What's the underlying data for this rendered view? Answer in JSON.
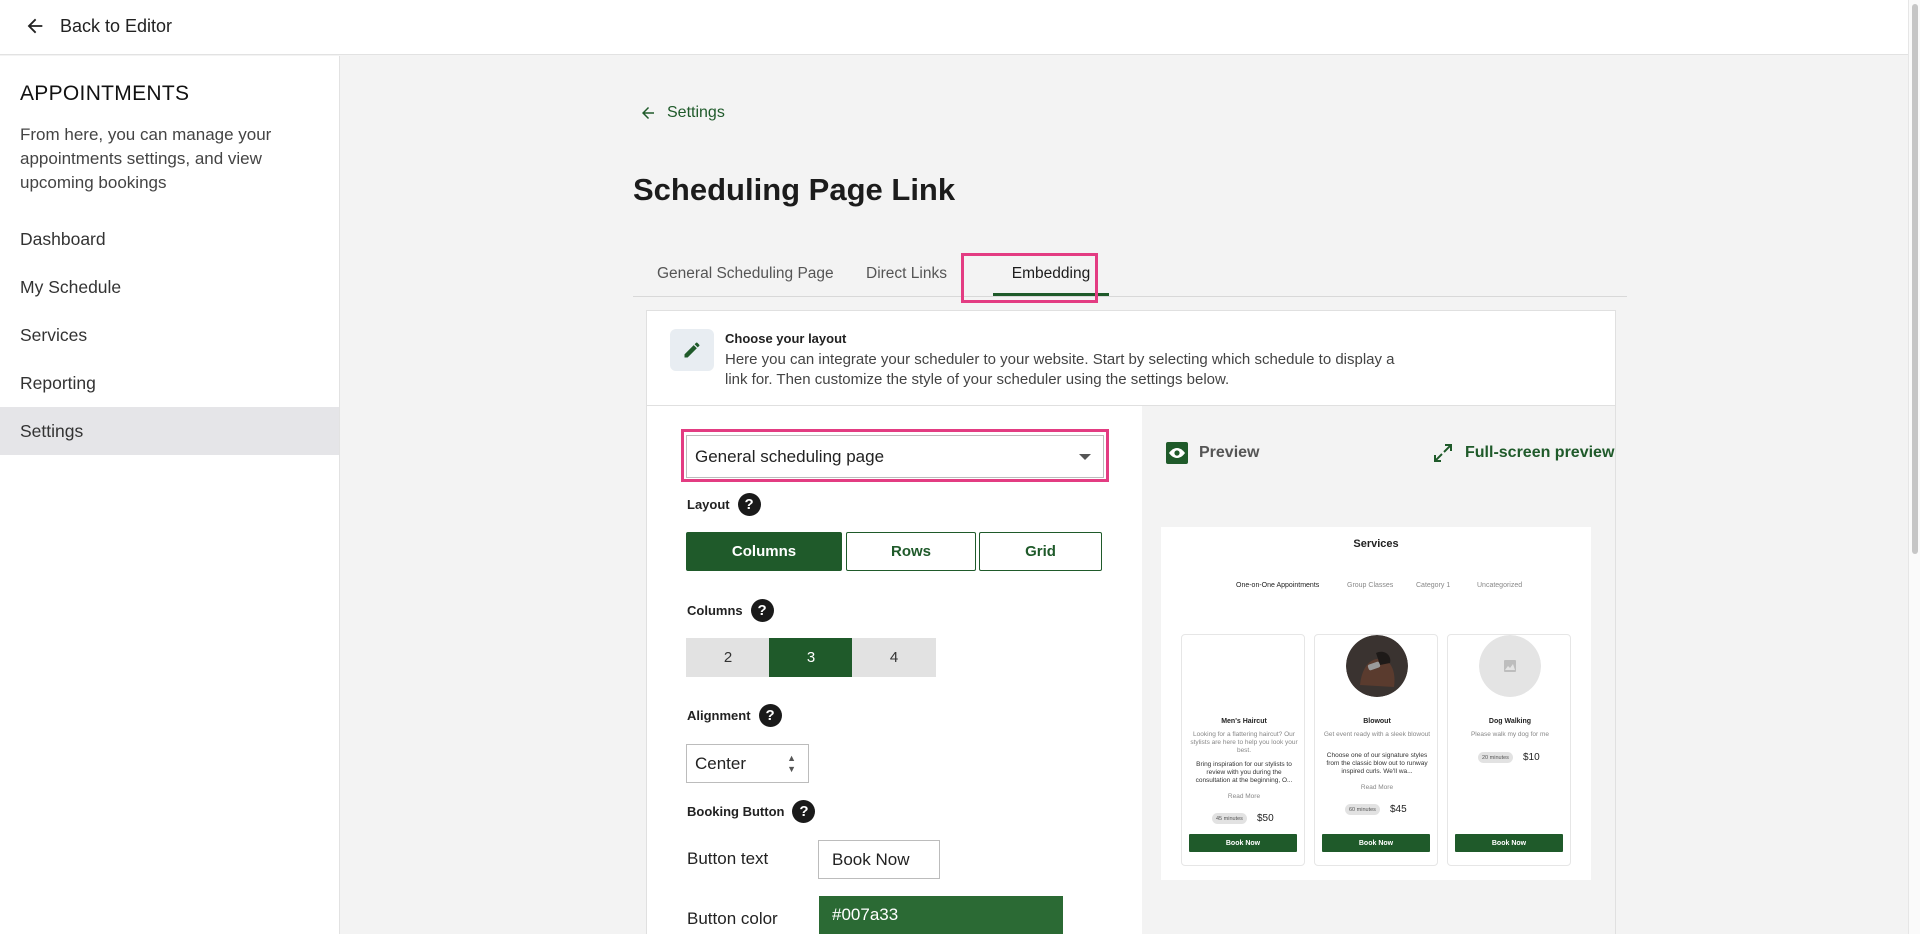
{
  "topbar": {
    "back_label": "Back to Editor"
  },
  "sidebar": {
    "title": "APPOINTMENTS",
    "description": "From here, you can manage your appointments settings, and view upcoming bookings",
    "items": [
      {
        "label": "Dashboard"
      },
      {
        "label": "My Schedule"
      },
      {
        "label": "Services"
      },
      {
        "label": "Reporting"
      },
      {
        "label": "Settings",
        "active": true
      }
    ]
  },
  "main": {
    "breadcrumb": "Settings",
    "title": "Scheduling Page Link",
    "tabs": [
      {
        "label": "General Scheduling Page"
      },
      {
        "label": "Direct Links"
      },
      {
        "label": "Embedding",
        "active": true
      }
    ],
    "info": {
      "title": "Choose your layout",
      "text": "Here you can integrate your scheduler to your website. Start by selecting which schedule to display a link for. Then customize the style of your scheduler using the settings below.",
      "icon": "pencil-icon"
    },
    "schedule_select": {
      "value": "General scheduling page"
    },
    "layout": {
      "label": "Layout",
      "options": [
        "Columns",
        "Rows",
        "Grid"
      ],
      "selected": "Columns"
    },
    "columns": {
      "label": "Columns",
      "options": [
        "2",
        "3",
        "4"
      ],
      "selected": "3"
    },
    "alignment": {
      "label": "Alignment",
      "value": "Center"
    },
    "booking_button": {
      "label": "Booking Button",
      "text_label": "Button text",
      "text_value": "Book Now",
      "color_label": "Button color",
      "color_value": "#007a33"
    },
    "preview": {
      "preview_label": "Preview",
      "fullscreen_label": "Full-screen preview"
    }
  },
  "mock": {
    "title": "Services",
    "tabs": [
      "One-on-One Appointments",
      "Group Classes",
      "Category 1",
      "Uncategorized"
    ],
    "cards": [
      {
        "name": "Men's Haircut",
        "summary": "Looking for a flattering haircut? Our stylists are here to help you look your best.",
        "details": "Bring inspiration for our stylists to review with you during the consultation at the beginning, O...",
        "read_more": "Read More",
        "duration": "45 minutes",
        "price": "$50",
        "button": "Book Now"
      },
      {
        "name": "Blowout",
        "summary": "Get event ready with a sleek blowout",
        "details": "Choose one of our signature styles from the classic blow out to runway inspired curls. We'll wa...",
        "read_more": "Read More",
        "duration": "60 minutes",
        "price": "$45",
        "button": "Book Now"
      },
      {
        "name": "Dog Walking",
        "summary": "Please walk my dog for me",
        "duration": "20 minutes",
        "price": "$10",
        "button": "Book Now"
      }
    ]
  },
  "colors": {
    "brand_green": "#1f5a2a",
    "highlight_pink": "#e33c82",
    "button_color": "#007a33"
  }
}
